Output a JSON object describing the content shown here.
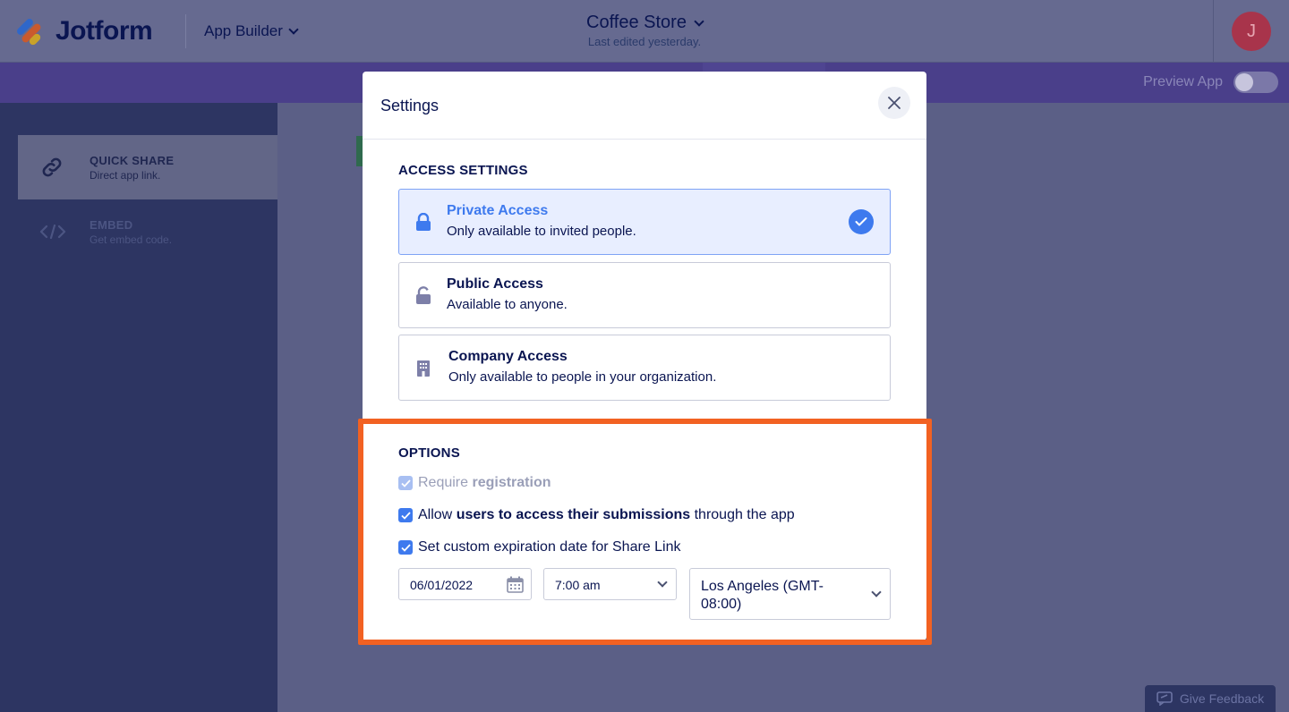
{
  "header": {
    "brand": "Jotform",
    "product_menu": "App Builder",
    "app_title": "Coffee Store",
    "app_subtitle": "Last edited yesterday.",
    "avatar_initial": "J"
  },
  "toolbar": {
    "preview_label": "Preview App",
    "preview_enabled": false
  },
  "sidebar": {
    "items": [
      {
        "title": "QUICK SHARE",
        "subtitle": "Direct app link.",
        "icon": "link-icon",
        "active": true
      },
      {
        "title": "EMBED",
        "subtitle": "Get embed code.",
        "icon": "code-icon",
        "active": false
      }
    ]
  },
  "feedback": {
    "label": "Give Feedback",
    "icon": "feedback-icon"
  },
  "modal": {
    "title": "Settings",
    "close_icon": "close-icon",
    "access_section": "ACCESS SETTINGS",
    "access_options": [
      {
        "name": "Private Access",
        "description": "Only available to invited people.",
        "icon": "lock-icon",
        "selected": true
      },
      {
        "name": "Public Access",
        "description": "Available to anyone.",
        "icon": "lock-icon",
        "selected": false
      },
      {
        "name": "Company Access",
        "description": "Only available to people in your organization.",
        "icon": "building-icon",
        "selected": false
      }
    ],
    "options_section": "OPTIONS",
    "options": {
      "require_registration": {
        "pre": "Require ",
        "bold": "registration",
        "post": "",
        "checked": true,
        "disabled": true
      },
      "allow_submissions": {
        "pre": "Allow ",
        "bold": "users to access their submissions",
        "post": " through the app",
        "checked": true,
        "disabled": false
      },
      "custom_expiration": {
        "pre": "Set custom expiration date for Share Link",
        "bold": "",
        "post": "",
        "checked": true,
        "disabled": false
      }
    },
    "expiration": {
      "date": "06/01/2022",
      "time": "7:00 am",
      "timezone_line1": "Los Angeles (GMT-",
      "timezone_line2": "08:00)"
    }
  },
  "colors": {
    "accent": "#3e7aee",
    "highlight": "#f26122",
    "sidebar": "#2d3562",
    "purple_bar": "#4a3f8a"
  }
}
